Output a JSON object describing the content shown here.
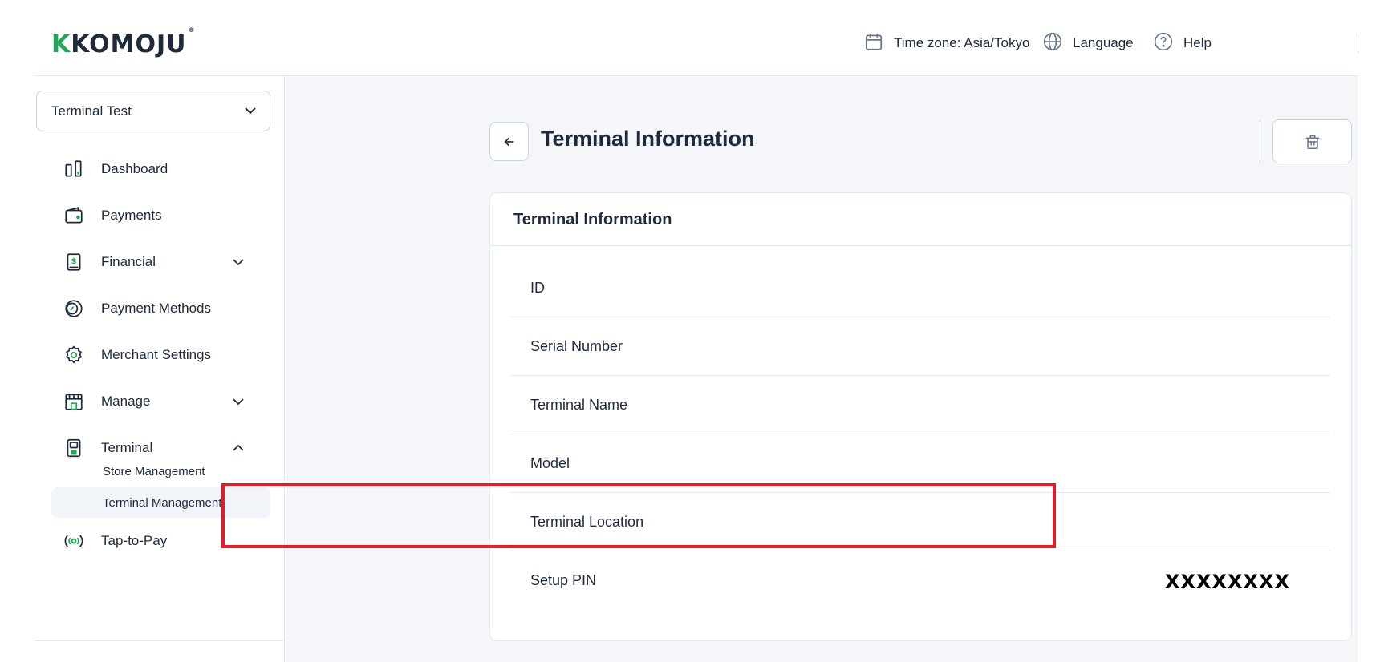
{
  "header": {
    "logo_text": "KOMOJU",
    "timezone_label": "Time zone: Asia/Tokyo",
    "language_label": "Language",
    "help_label": "Help"
  },
  "sidebar": {
    "store_select": "Terminal Test",
    "items": [
      {
        "label": "Dashboard",
        "icon": "dashboard-icon"
      },
      {
        "label": "Payments",
        "icon": "wallet-icon"
      },
      {
        "label": "Financial",
        "icon": "money-doc-icon",
        "expandable": true,
        "expanded": false
      },
      {
        "label": "Payment Methods",
        "icon": "coin-icon"
      },
      {
        "label": "Merchant Settings",
        "icon": "gear-icon"
      },
      {
        "label": "Manage",
        "icon": "store-icon",
        "expandable": true,
        "expanded": false
      },
      {
        "label": "Terminal",
        "icon": "terminal-icon",
        "expandable": true,
        "expanded": true
      },
      {
        "label": "Tap-to-Pay",
        "icon": "nfc-icon"
      }
    ],
    "terminal_subitems": [
      {
        "label": "Store Management",
        "active": false
      },
      {
        "label": "Terminal Management",
        "active": true
      }
    ]
  },
  "main": {
    "page_title": "Terminal Information",
    "card_title": "Terminal Information",
    "rows": [
      {
        "key": "ID",
        "value": ""
      },
      {
        "key": "Serial Number",
        "value": ""
      },
      {
        "key": "Terminal Name",
        "value": ""
      },
      {
        "key": "Model",
        "value": ""
      },
      {
        "key": "Terminal Location",
        "value": ""
      },
      {
        "key": "Setup PIN",
        "value": "XXXXXXXX"
      }
    ]
  },
  "colors": {
    "accent_green": "#1fa855",
    "highlight_red": "#e01e2a",
    "text_dark": "#1e293b",
    "main_bg": "#f4f6f9"
  }
}
